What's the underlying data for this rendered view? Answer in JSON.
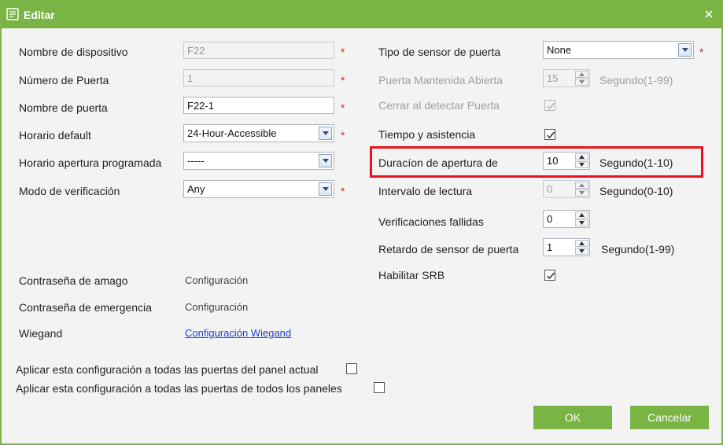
{
  "window": {
    "title": "Editar"
  },
  "left": {
    "device_name": {
      "label": "Nombre de dispositivo",
      "value": "F22"
    },
    "door_number": {
      "label": "Número de Puerta",
      "value": "1"
    },
    "door_name": {
      "label": "Nombre de puerta",
      "value": "F22-1"
    },
    "default_schedule": {
      "label": "Horario default",
      "value": "24-Hour-Accessible"
    },
    "programmed_schedule": {
      "label": "Horario apertura programada",
      "value": "-----"
    },
    "verify_mode": {
      "label": "Modo de verificación",
      "value": "Any"
    },
    "duress_password": {
      "label": "Contraseña de amago",
      "value": "Configuración"
    },
    "emergency_password": {
      "label": "Contraseña de emergencia",
      "value": "Configuración"
    },
    "wiegand": {
      "label": "Wiegand",
      "value": "Configuración Wiegand"
    }
  },
  "right": {
    "door_sensor_type": {
      "label": "Tipo de sensor de puerta",
      "value": "None"
    },
    "door_held_open": {
      "label": "Puerta Mantenida Abierta",
      "value": "15",
      "unit": "Segundo(1-99)"
    },
    "close_on_detect": {
      "label": "Cerrar al detectar Puerta",
      "checked": true
    },
    "time_attendance": {
      "label": "Tiempo y asistencia",
      "checked": true
    },
    "open_duration": {
      "label": "Duracíon de apertura de",
      "value": "10",
      "unit": "Segundo(1-10)"
    },
    "read_interval": {
      "label": "Intervalo de lectura",
      "value": "0",
      "unit": "Segundo(0-10)"
    },
    "failed_verifications": {
      "label": "Verificaciones fallidas",
      "value": "0"
    },
    "sensor_delay": {
      "label": "Retardo de sensor de puerta",
      "value": "1",
      "unit": "Segundo(1-99)"
    },
    "enable_srb": {
      "label": "Habilitar SRB",
      "checked": true
    }
  },
  "apply": {
    "current_panel": {
      "label": "Aplicar esta configuración a todas las puertas del panel actual",
      "checked": false
    },
    "all_panels": {
      "label": "Aplicar esta configuración a todas las puertas de todos los paneles",
      "checked": false
    }
  },
  "buttons": {
    "ok": "OK",
    "cancel": "Cancelar"
  },
  "required_mark": "*",
  "colors": {
    "accent": "#79b445",
    "highlight": "#e8121a",
    "link": "#1f3fd0"
  }
}
